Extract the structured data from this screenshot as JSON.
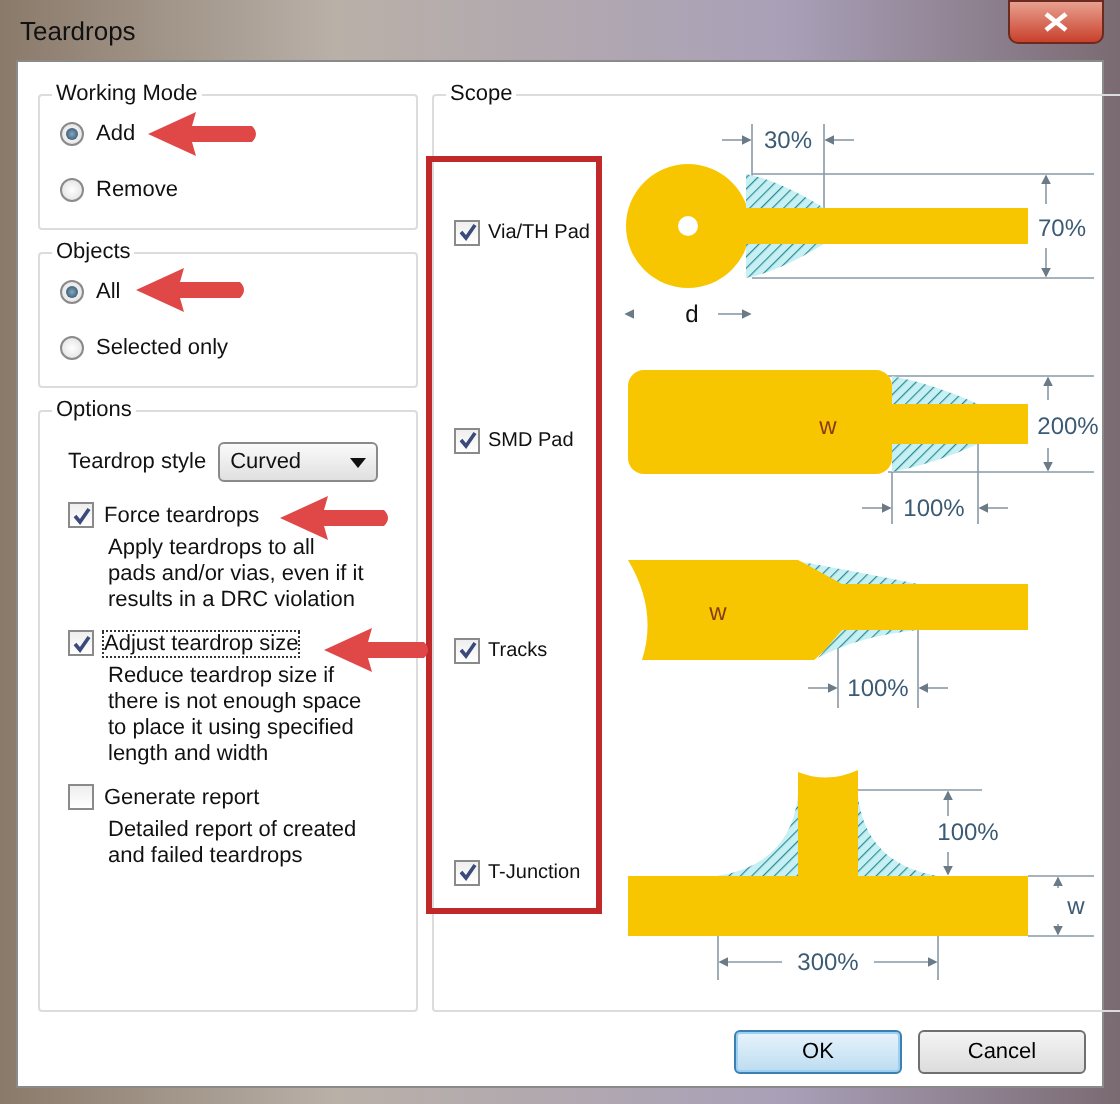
{
  "window": {
    "title": "Teardrops"
  },
  "working_mode": {
    "title": "Working Mode",
    "options": [
      {
        "label": "Add",
        "selected": true
      },
      {
        "label": "Remove",
        "selected": false
      }
    ]
  },
  "objects": {
    "title": "Objects",
    "options": [
      {
        "label": "All",
        "selected": true
      },
      {
        "label": "Selected only",
        "selected": false
      }
    ]
  },
  "options": {
    "title": "Options",
    "style_label": "Teardrop style",
    "style_value": "Curved",
    "checks": [
      {
        "label": "Force teardrops",
        "checked": true,
        "focused": false,
        "description": "Apply teardrops to all pads and/or vias, even if it results in a DRC violation"
      },
      {
        "label": "Adjust teardrop size",
        "checked": true,
        "focused": true,
        "description": "Reduce teardrop size if there is not enough space to place it using specified length and width"
      },
      {
        "label": "Generate report",
        "checked": false,
        "focused": false,
        "description": "Detailed report of created and failed teardrops"
      }
    ]
  },
  "scope": {
    "title": "Scope",
    "items": [
      {
        "kind": "via",
        "label": "Via/TH Pad",
        "checked": true,
        "dims": [
          "30%",
          "70%",
          "d"
        ]
      },
      {
        "kind": "smd",
        "label": "SMD Pad",
        "checked": true,
        "dims": [
          "w",
          "200%",
          "100%"
        ]
      },
      {
        "kind": "track",
        "label": "Tracks",
        "checked": true,
        "dims": [
          "w",
          "100%"
        ]
      },
      {
        "kind": "tjunction",
        "label": "T-Junction",
        "checked": true,
        "dims": [
          "100%",
          "w",
          "300%"
        ]
      }
    ]
  },
  "buttons": [
    {
      "label": "OK",
      "default": true
    },
    {
      "label": "Cancel",
      "default": false
    }
  ]
}
